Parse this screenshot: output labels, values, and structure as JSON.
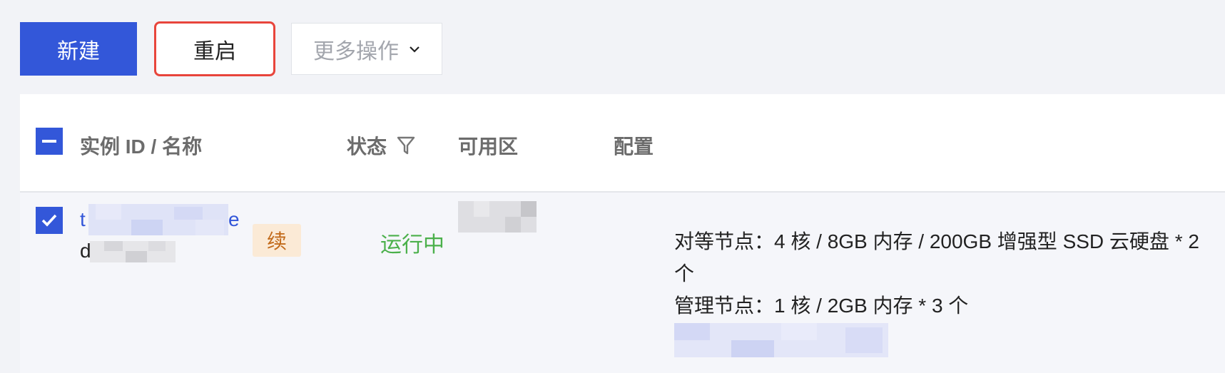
{
  "toolbar": {
    "new_label": "新建",
    "restart_label": "重启",
    "more_label": "更多操作"
  },
  "table": {
    "columns": [
      "实例 ID / 名称",
      "状态",
      "可用区",
      "配置"
    ],
    "rows": [
      {
        "id_prefix": "t",
        "name_prefix": "d",
        "renew_badge": "续",
        "status": "运行中",
        "config_lines": [
          "对等节点：4 核 / 8GB 内存 / 200GB 增强型 SSD 云硬盘 * 2 个",
          "管理节点：1 核 / 2GB 内存 * 3 个"
        ]
      }
    ]
  },
  "colors": {
    "primary": "#3357d9",
    "running_green": "#4bb04b",
    "highlight_red": "#e8453c",
    "badge_bg": "#fbead6",
    "badge_text": "#c26a1a"
  },
  "icons": {
    "header_checkbox": "minus-icon",
    "row_checkbox": "check-icon",
    "filter": "filter-icon",
    "more_dropdown": "chevron-down-icon"
  }
}
